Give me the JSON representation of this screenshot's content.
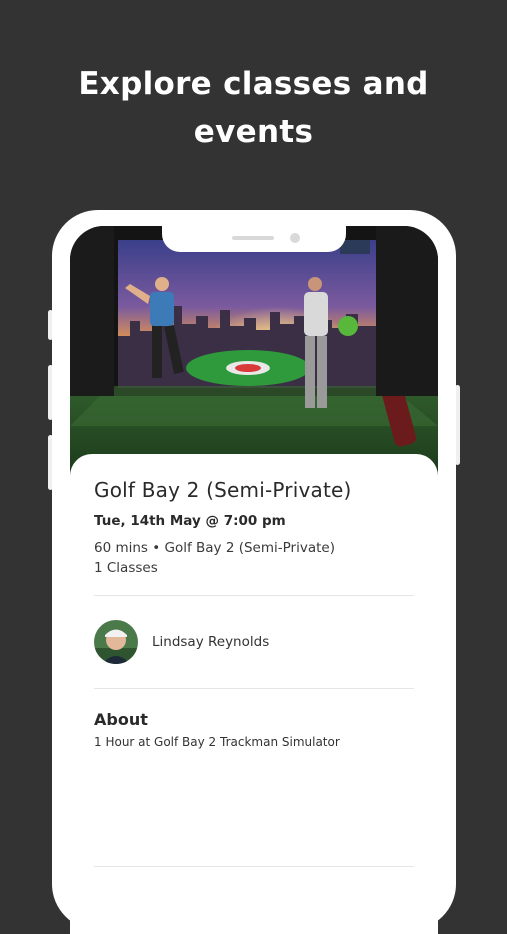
{
  "headline": {
    "line1": "Explore classes and",
    "line2": "events"
  },
  "event": {
    "title": "Golf Bay 2 (Semi-Private)",
    "datetime": "Tue, 14th May @ 7:00 pm",
    "details": "60 mins • Golf Bay 2 (Semi-Private)",
    "classes": "1 Classes"
  },
  "instructor": {
    "name": "Lindsay Reynolds"
  },
  "about": {
    "heading": "About",
    "text": "1  Hour at Golf Bay 2 Trackman Simulator"
  },
  "colors": {
    "background": "#333333",
    "card": "#ffffff",
    "text": "#2a2a2a"
  }
}
